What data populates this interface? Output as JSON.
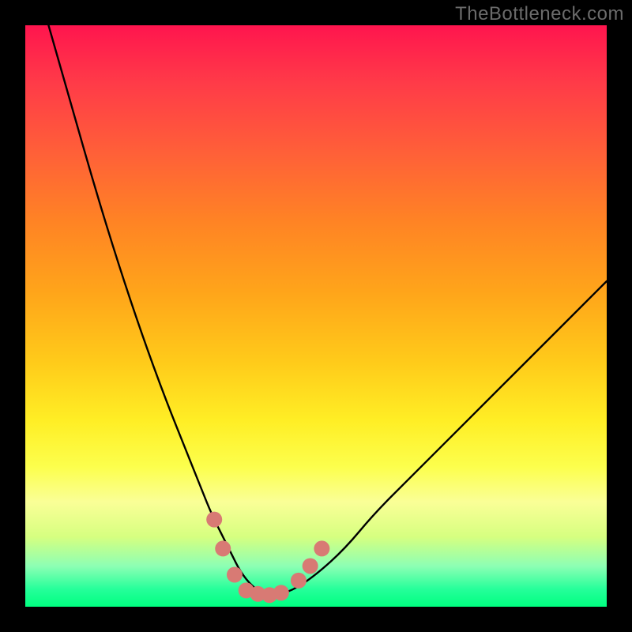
{
  "watermark": "TheBottleneck.com",
  "chart_data": {
    "type": "line",
    "title": "",
    "xlabel": "",
    "ylabel": "",
    "xlim": [
      0,
      100
    ],
    "ylim": [
      0,
      100
    ],
    "series": [
      {
        "name": "bottleneck-curve",
        "x": [
          4,
          8,
          12,
          16,
          20,
          24,
          28,
          30,
          32,
          34,
          35.5,
          37,
          39,
          41,
          43,
          46,
          50,
          55,
          60,
          66,
          73,
          80,
          88,
          96,
          100
        ],
        "y": [
          100,
          86,
          72,
          59,
          47,
          36,
          26,
          21,
          16,
          12,
          9,
          6,
          3.5,
          2.2,
          2,
          2.8,
          5.5,
          10,
          16,
          22,
          29,
          36,
          44,
          52,
          56
        ]
      }
    ],
    "markers": [
      {
        "name": "left-cluster-high",
        "x": 32.5,
        "y": 15
      },
      {
        "name": "left-cluster-mid",
        "x": 34.0,
        "y": 10
      },
      {
        "name": "left-cluster-low",
        "x": 36.0,
        "y": 5.5
      },
      {
        "name": "bottom-bar-a",
        "x": 38.0,
        "y": 2.8
      },
      {
        "name": "bottom-bar-b",
        "x": 40.0,
        "y": 2.2
      },
      {
        "name": "bottom-bar-c",
        "x": 42.0,
        "y": 2.0
      },
      {
        "name": "bottom-bar-d",
        "x": 44.0,
        "y": 2.4
      },
      {
        "name": "right-cluster-low",
        "x": 47.0,
        "y": 4.5
      },
      {
        "name": "right-cluster-mid",
        "x": 49.0,
        "y": 7.0
      },
      {
        "name": "right-cluster-high",
        "x": 51.0,
        "y": 10.0
      }
    ],
    "marker_style": {
      "color": "#d87a74",
      "radius_px": 10
    },
    "grid": false,
    "legend": false
  }
}
